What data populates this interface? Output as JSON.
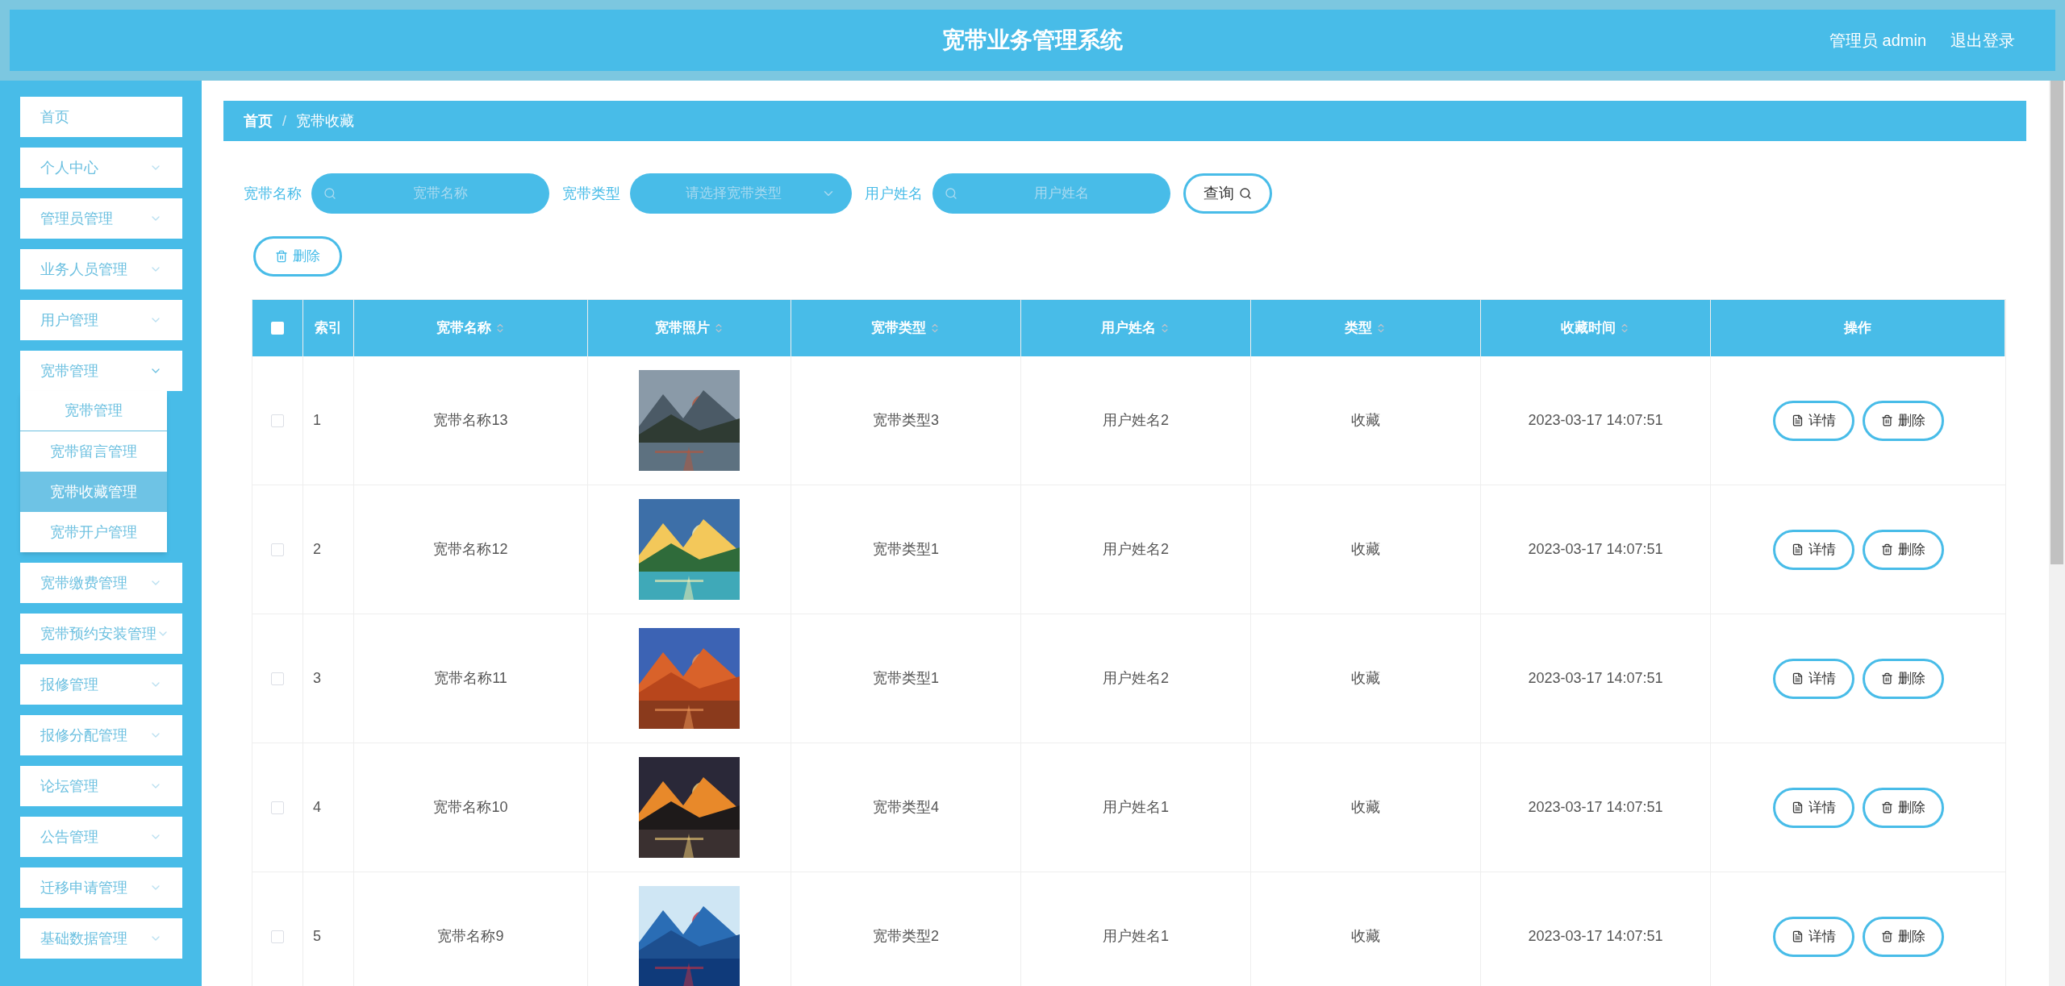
{
  "header": {
    "title": "宽带业务管理系统",
    "user": "管理员 admin",
    "logout": "退出登录"
  },
  "sidebar": {
    "items": [
      {
        "label": "首页",
        "kind": "link"
      },
      {
        "label": "个人中心",
        "kind": "menu",
        "expanded": false
      },
      {
        "label": "管理员管理",
        "kind": "menu",
        "expanded": false
      },
      {
        "label": "业务人员管理",
        "kind": "menu",
        "expanded": false
      },
      {
        "label": "用户管理",
        "kind": "menu",
        "expanded": false
      },
      {
        "label": "宽带管理",
        "kind": "menu",
        "expanded": true,
        "children": [
          {
            "label": "宽带管理",
            "selected": false
          },
          {
            "label": "宽带留言管理",
            "selected": false
          },
          {
            "label": "宽带收藏管理",
            "selected": true
          },
          {
            "label": "宽带开户管理",
            "selected": false
          }
        ]
      },
      {
        "label": "宽带缴费管理",
        "kind": "menu",
        "expanded": false
      },
      {
        "label": "宽带预约安装管理",
        "kind": "menu",
        "expanded": false
      },
      {
        "label": "报修管理",
        "kind": "menu",
        "expanded": false
      },
      {
        "label": "报修分配管理",
        "kind": "menu",
        "expanded": false
      },
      {
        "label": "论坛管理",
        "kind": "menu",
        "expanded": false
      },
      {
        "label": "公告管理",
        "kind": "menu",
        "expanded": false
      },
      {
        "label": "迁移申请管理",
        "kind": "menu",
        "expanded": false
      },
      {
        "label": "基础数据管理",
        "kind": "menu",
        "expanded": false
      }
    ]
  },
  "breadcrumb": [
    "首页",
    "宽带收藏"
  ],
  "breadcrumb_separator": "/",
  "search": {
    "fields": [
      {
        "label": "宽带名称",
        "kind": "input",
        "placeholder": "宽带名称"
      },
      {
        "label": "宽带类型",
        "kind": "select",
        "placeholder": "请选择宽带类型"
      },
      {
        "label": "用户姓名",
        "kind": "input",
        "placeholder": "用户姓名"
      }
    ],
    "query_button": "查询"
  },
  "delete_button": "删除",
  "table": {
    "select_all_checked": false,
    "columns": [
      {
        "label": "索引",
        "sortable": false
      },
      {
        "label": "宽带名称",
        "sortable": true
      },
      {
        "label": "宽带照片",
        "sortable": true
      },
      {
        "label": "宽带类型",
        "sortable": true
      },
      {
        "label": "用户姓名",
        "sortable": true
      },
      {
        "label": "类型",
        "sortable": true
      },
      {
        "label": "收藏时间",
        "sortable": true
      },
      {
        "label": "操作",
        "sortable": false
      }
    ],
    "rows": [
      {
        "checked": false,
        "index": "1",
        "name": "宽带名称13",
        "photo": {
          "kind": "picture"
        },
        "type": "宽带类型3",
        "user": "用户姓名2",
        "kind": "收藏",
        "time": "2023-03-17 14:07:51",
        "actions": [
          "详情",
          "删除"
        ]
      },
      {
        "checked": false,
        "index": "2",
        "name": "宽带名称12",
        "photo": {
          "kind": "picture"
        },
        "type": "宽带类型1",
        "user": "用户姓名2",
        "kind": "收藏",
        "time": "2023-03-17 14:07:51",
        "actions": [
          "详情",
          "删除"
        ]
      },
      {
        "checked": false,
        "index": "3",
        "name": "宽带名称11",
        "photo": {
          "kind": "picture"
        },
        "type": "宽带类型1",
        "user": "用户姓名2",
        "kind": "收藏",
        "time": "2023-03-17 14:07:51",
        "actions": [
          "详情",
          "删除"
        ]
      },
      {
        "checked": false,
        "index": "4",
        "name": "宽带名称10",
        "photo": {
          "kind": "picture"
        },
        "type": "宽带类型4",
        "user": "用户姓名1",
        "kind": "收藏",
        "time": "2023-03-17 14:07:51",
        "actions": [
          "详情",
          "删除"
        ]
      },
      {
        "checked": false,
        "index": "5",
        "name": "宽带名称9",
        "photo": {
          "kind": "picture"
        },
        "type": "宽带类型2",
        "user": "用户姓名1",
        "kind": "收藏",
        "time": "2023-03-17 14:07:51",
        "actions": [
          "详情",
          "删除"
        ]
      }
    ]
  }
}
